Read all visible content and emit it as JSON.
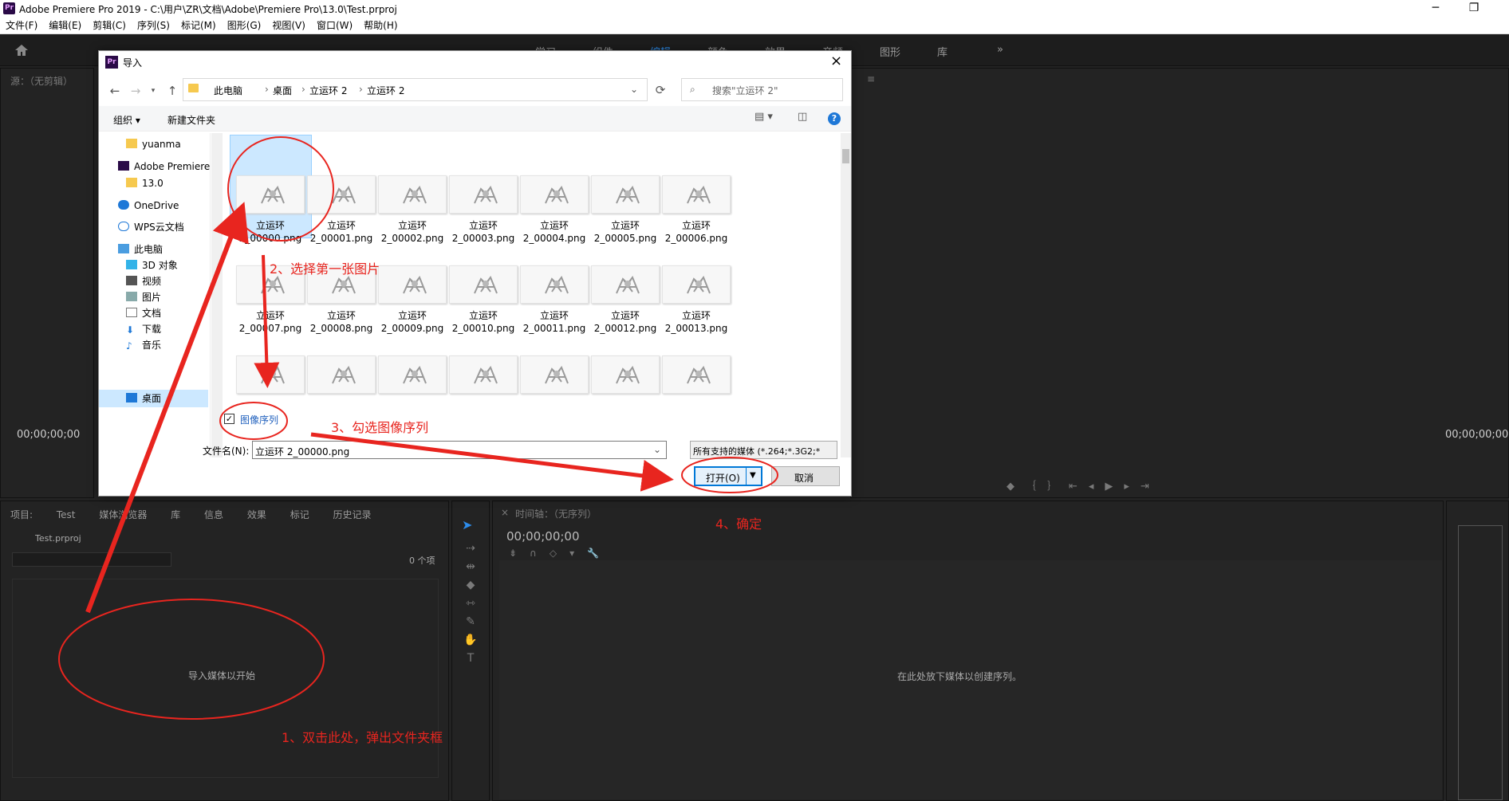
{
  "app": {
    "title": "Adobe Premiere Pro 2019 - C:\\用户\\ZR\\文档\\Adobe\\Premiere Pro\\13.0\\Test.prproj",
    "menu": [
      "文件(F)",
      "编辑(E)",
      "剪辑(C)",
      "序列(S)",
      "标记(M)",
      "图形(G)",
      "视图(V)",
      "窗口(W)",
      "帮助(H)"
    ],
    "workspaces": [
      "学习",
      "组件",
      "编辑",
      "颜色",
      "效果",
      "音频",
      "图形",
      "库"
    ],
    "source_panel_title": "源：（无剪辑）",
    "timecode_left": "00;00;00;00",
    "timecode_right": "00;00;00;00"
  },
  "project_panel": {
    "tabs": [
      "项目: Test",
      "媒体浏览器",
      "库",
      "信息",
      "效果",
      "标记",
      "历史记录"
    ],
    "file": "Test.prproj",
    "count": "0 个项",
    "placeholder": "导入媒体以开始"
  },
  "timeline": {
    "title": "时间轴：（无序列）",
    "timecode": "00;00;00;00",
    "placeholder": "在此处放下媒体以创建序列。"
  },
  "dialog": {
    "title": "导入",
    "breadcrumb": [
      "此电脑",
      "桌面",
      "立运环 2",
      "立运环 2"
    ],
    "search_placeholder": "搜索\"立运环 2\"",
    "organize": "组织 ▾",
    "new_folder": "新建文件夹",
    "tree": [
      {
        "label": "yuanma",
        "icon": "folder-icon"
      },
      {
        "label": "Adobe Premiere",
        "icon": "premiere-icon"
      },
      {
        "label": "13.0",
        "icon": "folder-icon"
      },
      {
        "label": "OneDrive",
        "icon": "onedrive-icon"
      },
      {
        "label": "WPS云文档",
        "icon": "wps-cloud-icon"
      },
      {
        "label": "此电脑",
        "icon": "computer-icon"
      },
      {
        "label": "3D 对象",
        "icon": "3d-objects-icon"
      },
      {
        "label": "视频",
        "icon": "video-icon"
      },
      {
        "label": "图片",
        "icon": "pictures-icon"
      },
      {
        "label": "文档",
        "icon": "documents-icon"
      },
      {
        "label": "下载",
        "icon": "download-icon"
      },
      {
        "label": "音乐",
        "icon": "music-icon"
      },
      {
        "label": "桌面",
        "icon": "desktop-icon"
      }
    ],
    "files_row1": [
      {
        "l1": "立运环",
        "l2": "2_00000.png"
      },
      {
        "l1": "立运环",
        "l2": "2_00001.png"
      },
      {
        "l1": "立运环",
        "l2": "2_00002.png"
      },
      {
        "l1": "立运环",
        "l2": "2_00003.png"
      },
      {
        "l1": "立运环",
        "l2": "2_00004.png"
      },
      {
        "l1": "立运环",
        "l2": "2_00005.png"
      },
      {
        "l1": "立运环",
        "l2": "2_00006.png"
      }
    ],
    "files_row2": [
      {
        "l1": "立运环",
        "l2": "2_00007.png"
      },
      {
        "l1": "立运环",
        "l2": "2_00008.png"
      },
      {
        "l1": "立运环",
        "l2": "2_00009.png"
      },
      {
        "l1": "立运环",
        "l2": "2_00010.png"
      },
      {
        "l1": "立运环",
        "l2": "2_00011.png"
      },
      {
        "l1": "立运环",
        "l2": "2_00012.png"
      },
      {
        "l1": "立运环",
        "l2": "2_00013.png"
      }
    ],
    "image_sequence_label": "图像序列",
    "image_sequence_checked": true,
    "filename_label": "文件名(N):",
    "filename_value": "立运环 2_00000.png",
    "filetype": "所有支持的媒体 (*.264;*.3G2;*",
    "open_button": "打开(O)",
    "cancel_button": "取消"
  },
  "annotations": {
    "step1": "1、双击此处，弹出文件夹框",
    "step2": "2、选择第一张图片",
    "step3": "3、勾选图像序列",
    "step4": "4、确定"
  },
  "colors": {
    "annotation": "#e8251f",
    "selection": "#cce8ff",
    "accent": "#2d8ceb"
  }
}
